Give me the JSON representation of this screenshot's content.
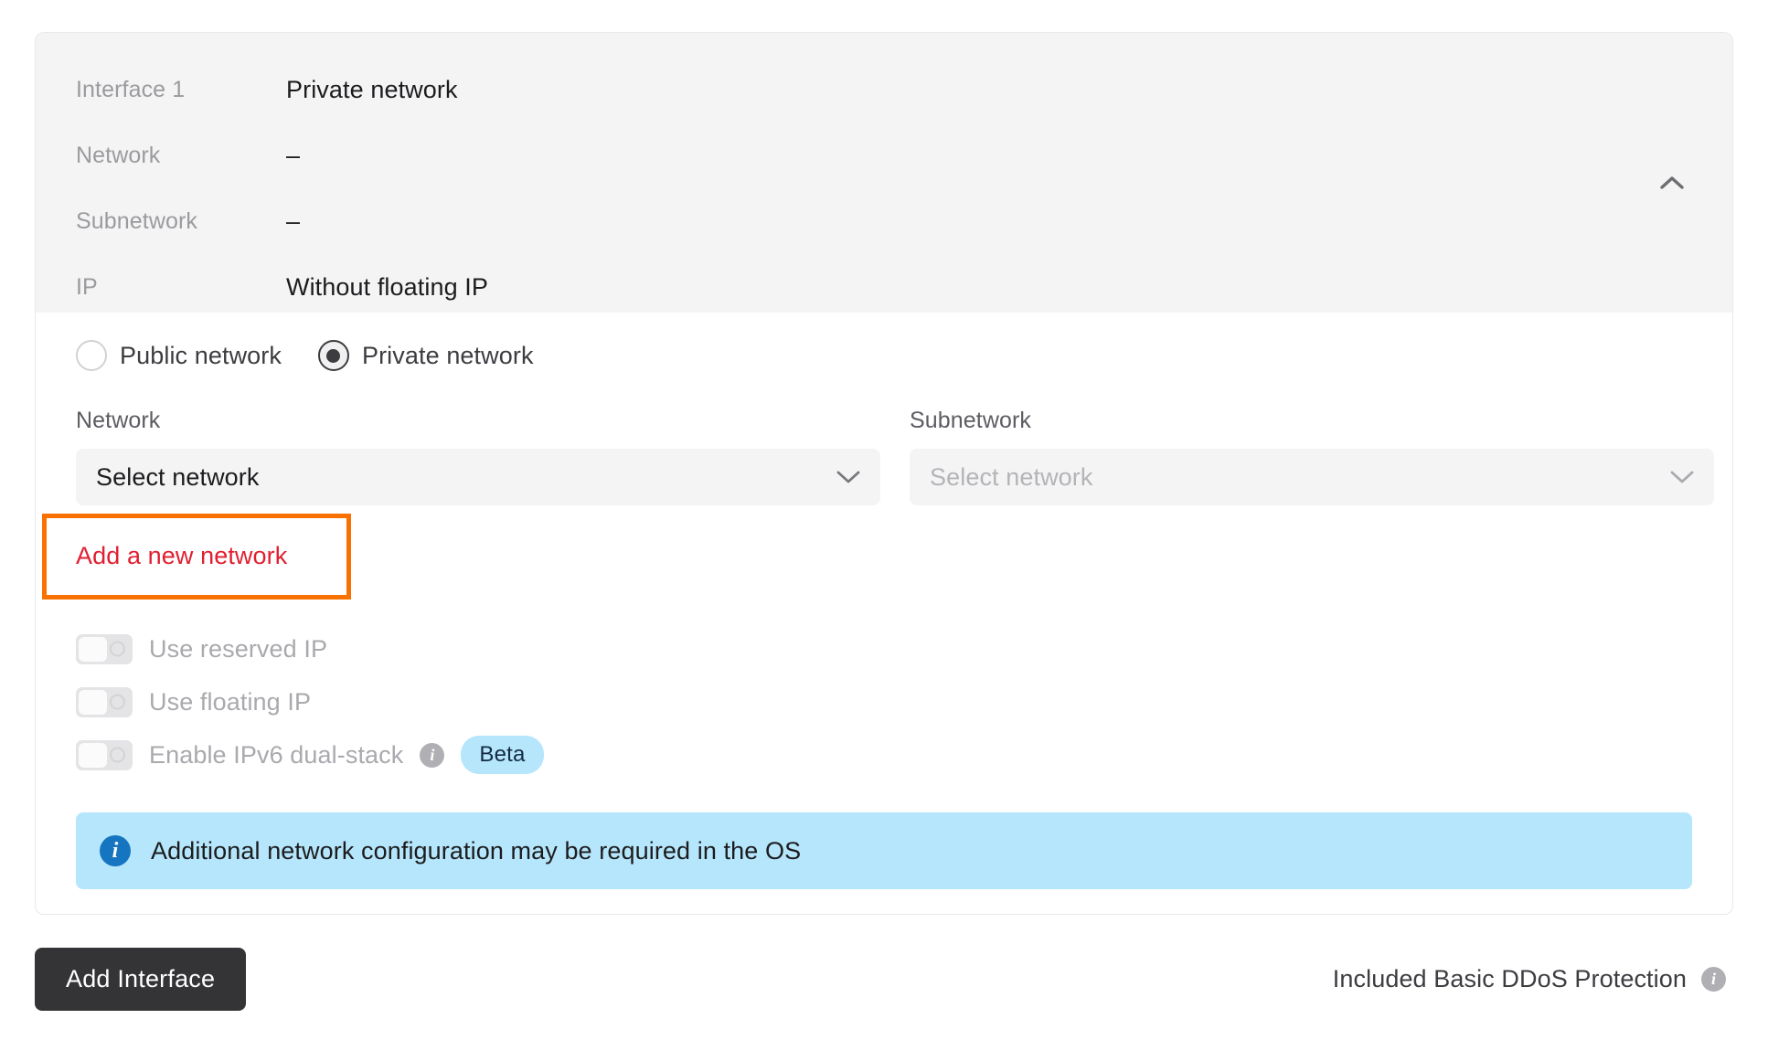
{
  "card": {
    "summary": {
      "rows": [
        {
          "label": "Interface 1",
          "value": "Private network"
        },
        {
          "label": "Network",
          "value": "–"
        },
        {
          "label": "Subnetwork",
          "value": "–"
        },
        {
          "label": "IP",
          "value": "Without floating IP"
        }
      ],
      "collapse_icon": "chevron-up-icon"
    },
    "network_type": {
      "options": [
        {
          "label": "Public network",
          "selected": false
        },
        {
          "label": "Private network",
          "selected": true
        }
      ]
    },
    "fields": [
      {
        "label": "Network",
        "value": "Select network",
        "disabled": false,
        "icon": "chevron-down-icon"
      },
      {
        "label": "Subnetwork",
        "value": "Select network",
        "disabled": true,
        "icon": "chevron-down-icon"
      }
    ],
    "add_network_link": {
      "label": "Add a new network",
      "color": "#e01f30",
      "highlight_color": "#f97100"
    },
    "toggles": [
      {
        "label": "Use reserved IP",
        "enabled": false,
        "on": false
      },
      {
        "label": "Use floating IP",
        "enabled": false,
        "on": false
      },
      {
        "label": "Enable IPv6 dual-stack",
        "enabled": false,
        "on": false,
        "info_icon": "info-icon",
        "badge": "Beta"
      }
    ],
    "banner": {
      "icon": "info-icon",
      "text": "Additional network configuration may be required in the OS",
      "background": "#b5e6fb"
    }
  },
  "footer": {
    "add_interface_label": "Add Interface",
    "ddos_text": "Included Basic DDoS Protection",
    "ddos_icon": "info-icon"
  }
}
